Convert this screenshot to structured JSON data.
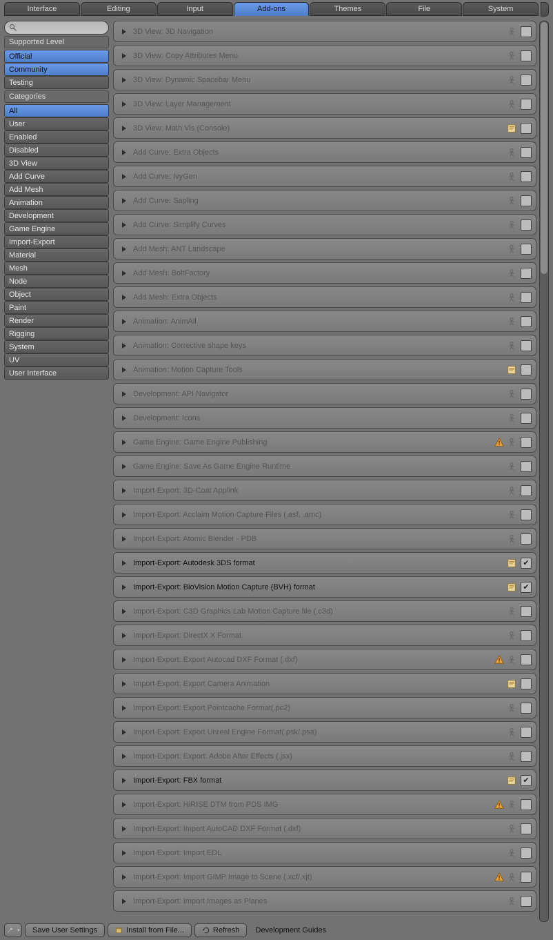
{
  "tabs": [
    "Interface",
    "Editing",
    "Input",
    "Add-ons",
    "Themes",
    "File",
    "System"
  ],
  "active_tab": 3,
  "search_placeholder": "",
  "sidebar": {
    "supported_label": "Supported Level",
    "supported": [
      {
        "label": "Official",
        "sel": true
      },
      {
        "label": "Community",
        "sel": true
      },
      {
        "label": "Testing",
        "sel": false
      }
    ],
    "categories_label": "Categories",
    "categories": [
      {
        "label": "All",
        "sel": true
      },
      {
        "label": "User",
        "sel": false
      },
      {
        "label": "Enabled",
        "sel": false
      },
      {
        "label": "Disabled",
        "sel": false
      },
      {
        "label": "3D View",
        "sel": false
      },
      {
        "label": "Add Curve",
        "sel": false
      },
      {
        "label": "Add Mesh",
        "sel": false
      },
      {
        "label": "Animation",
        "sel": false
      },
      {
        "label": "Development",
        "sel": false
      },
      {
        "label": "Game Engine",
        "sel": false
      },
      {
        "label": "Import-Export",
        "sel": false
      },
      {
        "label": "Material",
        "sel": false
      },
      {
        "label": "Mesh",
        "sel": false
      },
      {
        "label": "Node",
        "sel": false
      },
      {
        "label": "Object",
        "sel": false
      },
      {
        "label": "Paint",
        "sel": false
      },
      {
        "label": "Render",
        "sel": false
      },
      {
        "label": "Rigging",
        "sel": false
      },
      {
        "label": "System",
        "sel": false
      },
      {
        "label": "UV",
        "sel": false
      },
      {
        "label": "User Interface",
        "sel": false
      }
    ]
  },
  "addons": [
    {
      "label": "3D View: 3D Navigation",
      "doc": "human",
      "warn": false,
      "enabled": false
    },
    {
      "label": "3D View: Copy Attributes Menu",
      "doc": "human",
      "warn": false,
      "enabled": false
    },
    {
      "label": "3D View: Dynamic Spacebar Menu",
      "doc": "human",
      "warn": false,
      "enabled": false
    },
    {
      "label": "3D View: Layer Management",
      "doc": "human",
      "warn": false,
      "enabled": false
    },
    {
      "label": "3D View: Math Vis (Console)",
      "doc": "script",
      "warn": false,
      "enabled": false
    },
    {
      "label": "Add Curve: Extra Objects",
      "doc": "human",
      "warn": false,
      "enabled": false
    },
    {
      "label": "Add Curve: IvyGen",
      "doc": "human",
      "warn": false,
      "enabled": false
    },
    {
      "label": "Add Curve: Sapling",
      "doc": "human",
      "warn": false,
      "enabled": false
    },
    {
      "label": "Add Curve: Simplify Curves",
      "doc": "human",
      "warn": false,
      "enabled": false
    },
    {
      "label": "Add Mesh: ANT Landscape",
      "doc": "human",
      "warn": false,
      "enabled": false
    },
    {
      "label": "Add Mesh: BoltFactory",
      "doc": "human",
      "warn": false,
      "enabled": false
    },
    {
      "label": "Add Mesh: Extra Objects",
      "doc": "human",
      "warn": false,
      "enabled": false
    },
    {
      "label": "Animation: AnimAll",
      "doc": "human",
      "warn": false,
      "enabled": false
    },
    {
      "label": "Animation: Corrective shape keys",
      "doc": "human",
      "warn": false,
      "enabled": false
    },
    {
      "label": "Animation: Motion Capture Tools",
      "doc": "script",
      "warn": false,
      "enabled": false
    },
    {
      "label": "Development: API Navigator",
      "doc": "human",
      "warn": false,
      "enabled": false
    },
    {
      "label": "Development: Icons",
      "doc": "human",
      "warn": false,
      "enabled": false
    },
    {
      "label": "Game Engine: Game Engine Publishing",
      "doc": "human",
      "warn": true,
      "enabled": false
    },
    {
      "label": "Game Engine: Save As Game Engine Runtime",
      "doc": "human",
      "warn": false,
      "enabled": false
    },
    {
      "label": "Import-Export: 3D-Coat Applink",
      "doc": "human",
      "warn": false,
      "enabled": false
    },
    {
      "label": "Import-Export: Acclaim Motion Capture Files (.asf, .amc)",
      "doc": "human",
      "warn": false,
      "enabled": false
    },
    {
      "label": "Import-Export: Atomic Blender - PDB",
      "doc": "human",
      "warn": false,
      "enabled": false
    },
    {
      "label": "Import-Export: Autodesk 3DS format",
      "doc": "script",
      "warn": false,
      "enabled": true
    },
    {
      "label": "Import-Export: BioVision Motion Capture (BVH) format",
      "doc": "script",
      "warn": false,
      "enabled": true
    },
    {
      "label": "Import-Export: C3D Graphics Lab Motion Capture file (.c3d)",
      "doc": "human",
      "warn": false,
      "enabled": false
    },
    {
      "label": "Import-Export: DirectX X Format",
      "doc": "human",
      "warn": false,
      "enabled": false
    },
    {
      "label": "Import-Export: Export Autocad DXF Format (.dxf)",
      "doc": "human",
      "warn": true,
      "enabled": false
    },
    {
      "label": "Import-Export: Export Camera Animation",
      "doc": "script",
      "warn": false,
      "enabled": false
    },
    {
      "label": "Import-Export: Export Pointcache Format(.pc2)",
      "doc": "human",
      "warn": false,
      "enabled": false
    },
    {
      "label": "Import-Export: Export Unreal Engine Format(.psk/.psa)",
      "doc": "human",
      "warn": false,
      "enabled": false
    },
    {
      "label": "Import-Export: Export: Adobe After Effects (.jsx)",
      "doc": "human",
      "warn": false,
      "enabled": false
    },
    {
      "label": "Import-Export: FBX format",
      "doc": "script",
      "warn": false,
      "enabled": true
    },
    {
      "label": "Import-Export: HiRISE DTM from PDS IMG",
      "doc": "human",
      "warn": true,
      "enabled": false
    },
    {
      "label": "Import-Export: Import AutoCAD DXF Format (.dxf)",
      "doc": "human",
      "warn": false,
      "enabled": false
    },
    {
      "label": "Import-Export: Import EDL",
      "doc": "human",
      "warn": false,
      "enabled": false
    },
    {
      "label": "Import-Export: Import GIMP Image to Scene (.xcf/.xjt)",
      "doc": "human",
      "warn": true,
      "enabled": false
    },
    {
      "label": "Import-Export: Import Images as Planes",
      "doc": "human",
      "warn": false,
      "enabled": false
    }
  ],
  "bottom": {
    "save": "Save User Settings",
    "install": "Install from File...",
    "refresh": "Refresh",
    "guides": "Development Guides"
  }
}
